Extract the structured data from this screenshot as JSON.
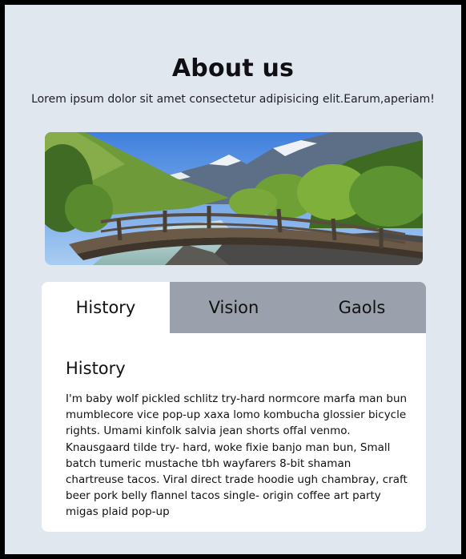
{
  "page": {
    "title": "About us",
    "subtitle": "Lorem ipsum dolor sit amet consectetur adipisicing elit.Earum,aperiam!"
  },
  "tabs": [
    {
      "label": "History",
      "active": true
    },
    {
      "label": "Vision",
      "active": false
    },
    {
      "label": "Gaols",
      "active": false
    }
  ],
  "panel": {
    "heading": "History",
    "body": "I'm baby wolf pickled schlitz try-hard normcore marfa man bun mumblecore vice pop-up xaxa lomo kombucha glossier bicycle rights. Umami kinfolk salvia jean shorts offal venmo. Knausgaard tilde try- hard, woke fixie banjo man bun, Small batch tumeric mustache tbh wayfarers 8-bit shaman chartreuse tacos. Viral direct trade hoodie ugh chambray, craft beer pork belly flannel tacos single- origin coffee art party migas plaid pop-up"
  },
  "colors": {
    "background": "#e1e7ef",
    "tab_inactive": "#9aa1ad",
    "tab_active": "#ffffff",
    "border": "#000000"
  }
}
